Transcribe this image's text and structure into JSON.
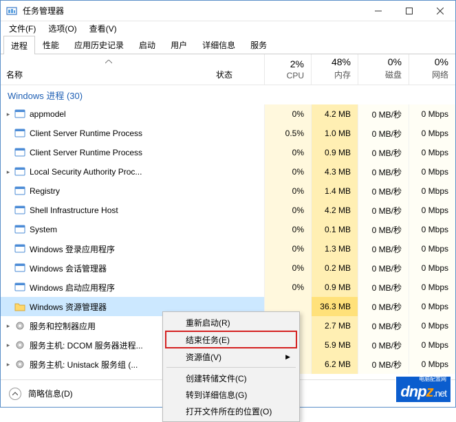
{
  "titlebar": {
    "title": "任务管理器"
  },
  "menubar": {
    "file": "文件(F)",
    "options": "选项(O)",
    "view": "查看(V)"
  },
  "tabs": [
    "进程",
    "性能",
    "应用历史记录",
    "启动",
    "用户",
    "详细信息",
    "服务"
  ],
  "headers": {
    "name": "名称",
    "status": "状态",
    "cpu_pct": "2%",
    "cpu": "CPU",
    "mem_pct": "48%",
    "mem": "内存",
    "disk_pct": "0%",
    "disk": "磁盘",
    "net_pct": "0%",
    "net": "网络"
  },
  "group": {
    "label": "Windows 进程 (30)"
  },
  "rows": [
    {
      "expand": true,
      "name": "appmodel",
      "cpu": "0%",
      "mem": "4.2 MB",
      "memHi": false,
      "disk": "0 MB/秒",
      "net": "0 Mbps"
    },
    {
      "expand": false,
      "name": "Client Server Runtime Process",
      "cpu": "0.5%",
      "mem": "1.0 MB",
      "memHi": false,
      "disk": "0 MB/秒",
      "net": "0 Mbps"
    },
    {
      "expand": false,
      "name": "Client Server Runtime Process",
      "cpu": "0%",
      "mem": "0.9 MB",
      "memHi": false,
      "disk": "0 MB/秒",
      "net": "0 Mbps"
    },
    {
      "expand": true,
      "name": "Local Security Authority Proc...",
      "cpu": "0%",
      "mem": "4.3 MB",
      "memHi": false,
      "disk": "0 MB/秒",
      "net": "0 Mbps"
    },
    {
      "expand": false,
      "name": "Registry",
      "cpu": "0%",
      "mem": "1.4 MB",
      "memHi": false,
      "disk": "0 MB/秒",
      "net": "0 Mbps"
    },
    {
      "expand": false,
      "name": "Shell Infrastructure Host",
      "cpu": "0%",
      "mem": "4.2 MB",
      "memHi": false,
      "disk": "0 MB/秒",
      "net": "0 Mbps"
    },
    {
      "expand": false,
      "name": "System",
      "cpu": "0%",
      "mem": "0.1 MB",
      "memHi": false,
      "disk": "0 MB/秒",
      "net": "0 Mbps"
    },
    {
      "expand": false,
      "name": "Windows 登录应用程序",
      "cpu": "0%",
      "mem": "1.3 MB",
      "memHi": false,
      "disk": "0 MB/秒",
      "net": "0 Mbps"
    },
    {
      "expand": false,
      "name": "Windows 会话管理器",
      "cpu": "0%",
      "mem": "0.2 MB",
      "memHi": false,
      "disk": "0 MB/秒",
      "net": "0 Mbps"
    },
    {
      "expand": false,
      "name": "Windows 启动应用程序",
      "cpu": "0%",
      "mem": "0.9 MB",
      "memHi": false,
      "disk": "0 MB/秒",
      "net": "0 Mbps"
    },
    {
      "expand": false,
      "name": "Windows 资源管理器",
      "cpu": "",
      "mem": "36.3 MB",
      "memHi": true,
      "disk": "0 MB/秒",
      "net": "0 Mbps",
      "selected": true,
      "folder": true
    },
    {
      "expand": true,
      "name": "服务和控制器应用",
      "cpu": "",
      "mem": "2.7 MB",
      "memHi": false,
      "disk": "0 MB/秒",
      "net": "0 Mbps"
    },
    {
      "expand": true,
      "name": "服务主机: DCOM 服务器进程...",
      "cpu": "",
      "mem": "5.9 MB",
      "memHi": false,
      "disk": "0 MB/秒",
      "net": "0 Mbps"
    },
    {
      "expand": true,
      "name": "服务主机: Unistack 服务组 (...",
      "cpu": "",
      "mem": "6.2 MB",
      "memHi": false,
      "disk": "0 MB/秒",
      "net": "0 Mbps"
    }
  ],
  "context_menu": {
    "items": [
      {
        "label": "重新启动(R)"
      },
      {
        "label": "结束任务(E)",
        "highlighted": true
      },
      {
        "label": "资源值(V)",
        "submenu": true
      },
      {
        "sep": true
      },
      {
        "label": "创建转储文件(C)"
      },
      {
        "label": "转到详细信息(G)"
      },
      {
        "label": "打开文件所在的位置(O)"
      }
    ]
  },
  "footer": {
    "label": "简略信息(D)"
  },
  "watermark": {
    "brand": "dnp",
    "brand2": "z",
    "domain": ".net",
    "sub": "电脑配置网"
  }
}
